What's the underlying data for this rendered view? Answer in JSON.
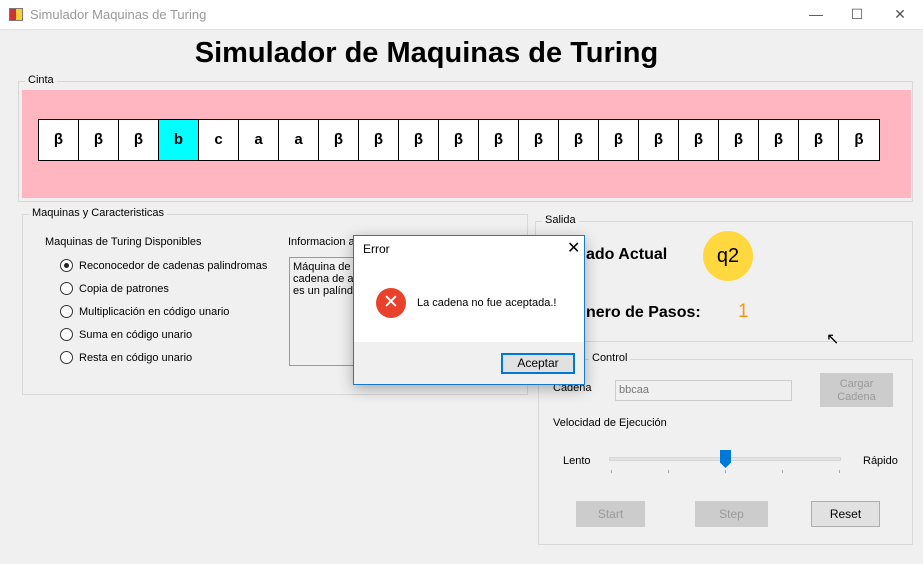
{
  "window": {
    "title": "Simulador Maquinas de Turing"
  },
  "header": {
    "title": "Simulador de Maquinas de Turing"
  },
  "tape": {
    "label": "Cinta",
    "cells": [
      "β",
      "β",
      "β",
      "b",
      "c",
      "a",
      "a",
      "β",
      "β",
      "β",
      "β",
      "β",
      "β",
      "β",
      "β",
      "β",
      "β",
      "β",
      "β",
      "β",
      "β"
    ],
    "head_index": 3,
    "highlight_color": "#00ffff"
  },
  "machines": {
    "group_label": "Maquinas y Caracteristicas",
    "list_label": "Maquinas de Turing Disponibles",
    "options": [
      "Reconocedor de cadenas palindromas",
      "Copia de patrones",
      "Multiplicación en código unario",
      "Suma en código unario",
      "Resta en código unario"
    ],
    "selected": 0,
    "info_label": "Informacion ac",
    "info_text": "Máquina de T\ncadena de a,\nes un palíndr"
  },
  "output": {
    "group_label": "Salida",
    "state_label": "ado Actual",
    "state_value": "q2",
    "steps_label": "nero de Pasos:",
    "steps_value": "1"
  },
  "control": {
    "group_label": "Control",
    "cadena_label": "Cadena",
    "cadena_value": "bbcaa",
    "load_button": "Cargar Cadena",
    "speed_label": "Velocidad de Ejecución",
    "slow": "Lento",
    "fast": "Rápido",
    "speed_fraction": 0.5,
    "start": "Start",
    "step": "Step",
    "reset": "Reset"
  },
  "dialog": {
    "title": "Error",
    "message": "La cadena no fue aceptada.!",
    "ok": "Aceptar"
  }
}
